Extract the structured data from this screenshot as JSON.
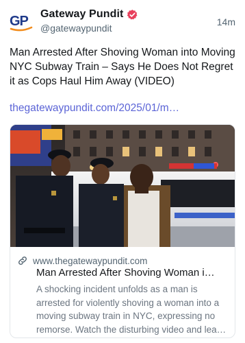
{
  "author": {
    "display_name": "Gateway Pundit",
    "handle": "@gatewaypundit",
    "avatar_text": "GP",
    "verified": true,
    "verified_color": "#e8405c"
  },
  "post": {
    "timestamp": "14m",
    "text": "Man Arrested After Shoving Woman into Moving NYC Subway Train – Says He Does Not Regret it as Cops Haul Him Away (VIDEO)",
    "link_text": "thegatewaypundit.com/2025/01/m…"
  },
  "link_card": {
    "domain": "www.thegatewaypundit.com",
    "title": "Man Arrested After Shoving Woman i…",
    "description": "A shocking incident unfolds as a man is arrested for violently shoving a woman into a moving subway train in NYC, expressing no remorse. Watch the disturbing video and lea…",
    "image_alt": "police officers arresting a man beside a patrol car at night"
  },
  "colors": {
    "link": "#5b64d6",
    "logo_blue": "#1f3a8a",
    "logo_orange": "#f28c1c"
  },
  "icons": {
    "verified": "verified-badge-icon",
    "link": "link-chain-icon"
  }
}
